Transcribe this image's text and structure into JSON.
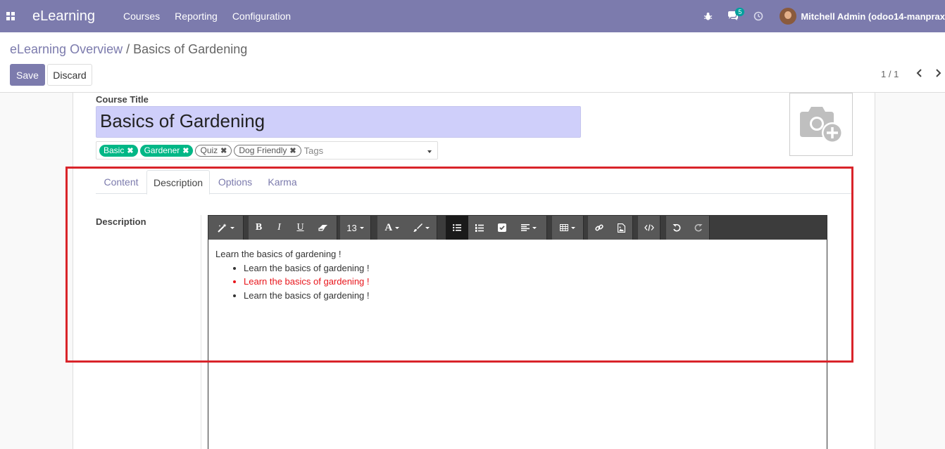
{
  "navbar": {
    "app_name": "eLearning",
    "menu": [
      "Courses",
      "Reporting",
      "Configuration"
    ],
    "message_count": "5",
    "user_name": "Mitchell Admin (odoo14-manprax"
  },
  "breadcrumb": {
    "parent": "eLearning Overview",
    "separator": "/",
    "current": "Basics of Gardening"
  },
  "buttons": {
    "save": "Save",
    "discard": "Discard"
  },
  "pager": {
    "value": "1 / 1"
  },
  "form": {
    "course_title_label": "Course Title",
    "course_title": "Basics of Gardening",
    "tags": [
      {
        "label": "Basic",
        "color": "#00b786"
      },
      {
        "label": "Gardener",
        "color": "#00b786"
      },
      {
        "label": "Quiz",
        "color": "#ffffff"
      },
      {
        "label": "Dog Friendly",
        "color": "#ffffff"
      }
    ],
    "tags_placeholder": "Tags"
  },
  "tabs": [
    "Content",
    "Description",
    "Options",
    "Karma"
  ],
  "active_tab": "Description",
  "description": {
    "label": "Description",
    "toolbar": {
      "font_size": "13",
      "font_color_glyph": "A",
      "bold": "B",
      "italic": "I",
      "underline": "U"
    },
    "content": {
      "paragraph": "Learn the basics of gardening !",
      "bullets": [
        {
          "text": "Learn the basics of gardening !",
          "color": "#333333"
        },
        {
          "text": "Learn the basics of gardening !",
          "color": "#e8151b"
        },
        {
          "text": "Learn the basics of gardening !",
          "color": "#333333"
        }
      ]
    }
  },
  "colors": {
    "brand": "#7c7bad",
    "highlight_border": "#d9242a",
    "tag_green": "#00b786"
  }
}
